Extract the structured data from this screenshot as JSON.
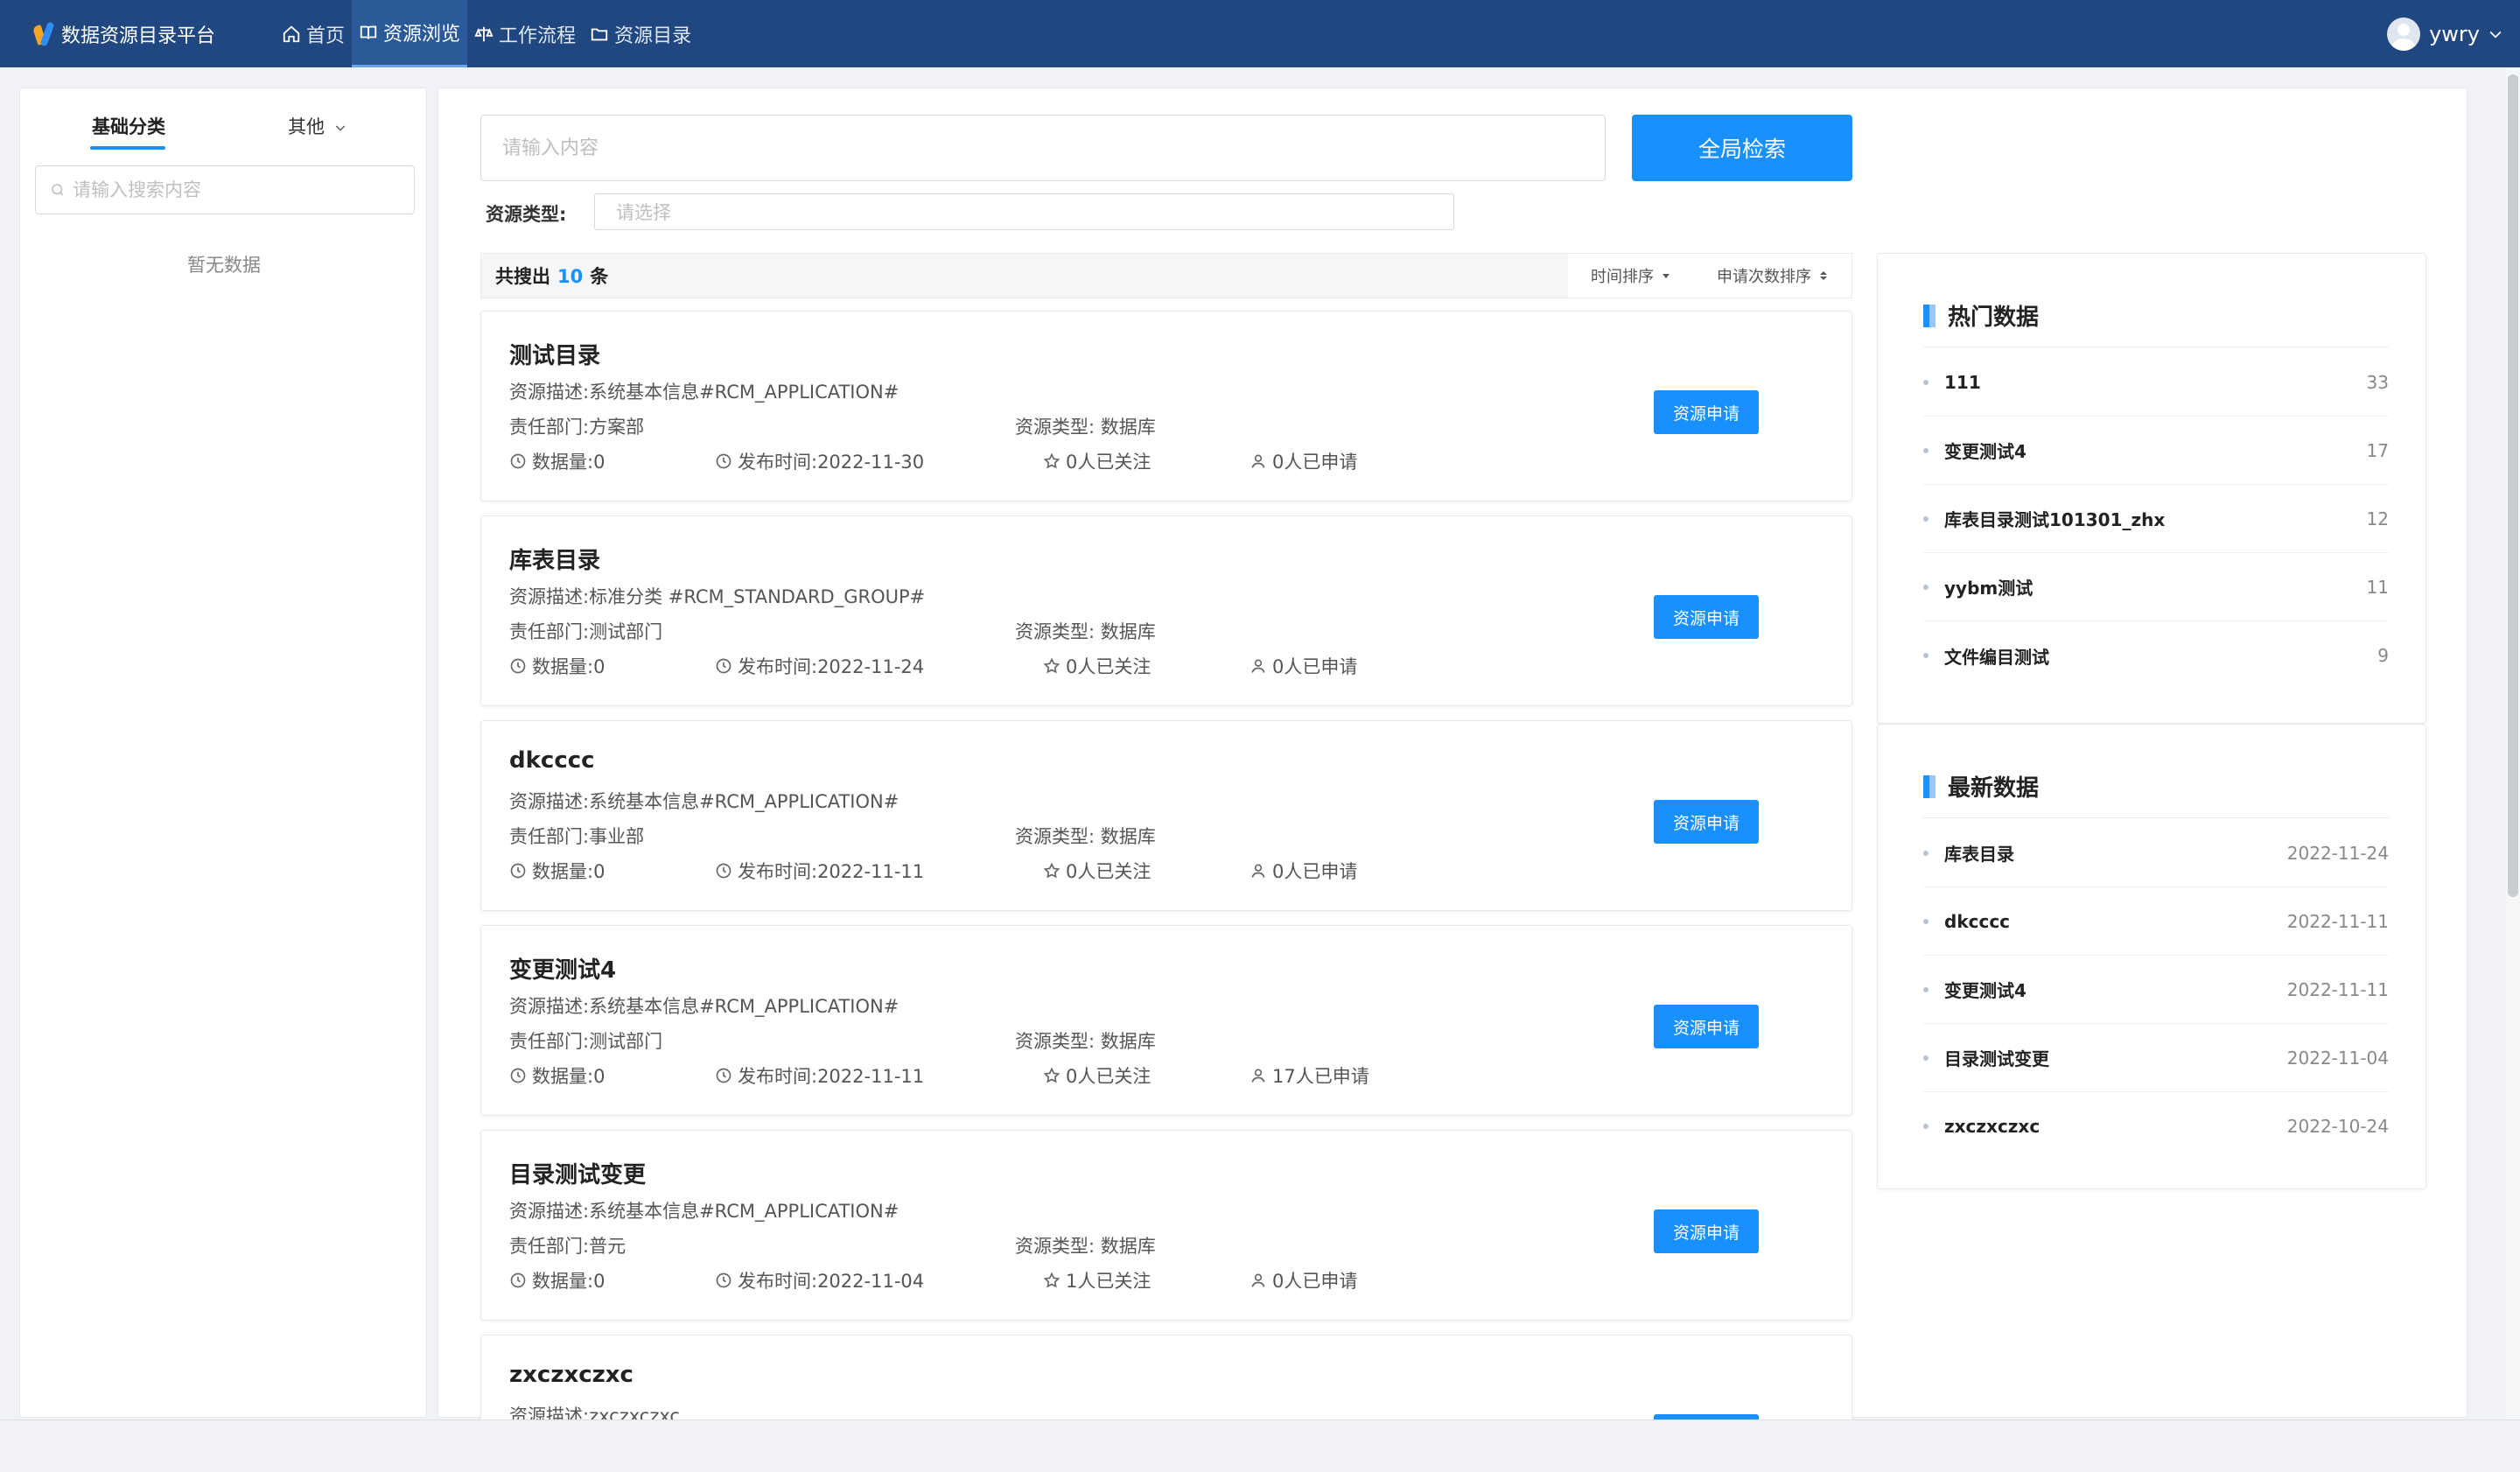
{
  "app": {
    "title": "数据资源目录平台"
  },
  "nav": {
    "items": [
      {
        "label": "首页",
        "icon": "home-icon"
      },
      {
        "label": "资源浏览",
        "icon": "book-icon",
        "active": true
      },
      {
        "label": "工作流程",
        "icon": "scale-icon"
      },
      {
        "label": "资源目录",
        "icon": "folder-icon"
      }
    ]
  },
  "user": {
    "name": "ywry"
  },
  "left": {
    "tabs": [
      "基础分类",
      "其他"
    ],
    "search_placeholder": "请输入搜索内容",
    "empty_text": "暂无数据"
  },
  "search": {
    "placeholder": "请输入内容",
    "button": "全局检索",
    "type_label": "资源类型:",
    "type_placeholder": "请选择"
  },
  "results": {
    "prefix": "共搜出",
    "count": "10",
    "suffix": "条",
    "sort_time": "时间排序",
    "sort_apply": "申请次数排序"
  },
  "cards": [
    {
      "title": "测试目录",
      "desc": "资源描述:系统基本信息#RCM_APPLICATION#",
      "dept": "责任部门:方案部",
      "type": "资源类型:  数据库",
      "count": "数据量:0",
      "date": "发布时间:2022-11-30",
      "follow": "0人已关注",
      "apply": "0人已申请",
      "button": "资源申请"
    },
    {
      "title": "库表目录",
      "desc": "资源描述:标准分类 #RCM_STANDARD_GROUP#",
      "dept": "责任部门:测试部门",
      "type": "资源类型:  数据库",
      "count": "数据量:0",
      "date": "发布时间:2022-11-24",
      "follow": "0人已关注",
      "apply": "0人已申请",
      "button": "资源申请"
    },
    {
      "title": "dkcccc",
      "desc": "资源描述:系统基本信息#RCM_APPLICATION#",
      "dept": "责任部门:事业部",
      "type": "资源类型:  数据库",
      "count": "数据量:0",
      "date": "发布时间:2022-11-11",
      "follow": "0人已关注",
      "apply": "0人已申请",
      "button": "资源申请"
    },
    {
      "title": "变更测试4",
      "desc": "资源描述:系统基本信息#RCM_APPLICATION#",
      "dept": "责任部门:测试部门",
      "type": "资源类型:  数据库",
      "count": "数据量:0",
      "date": "发布时间:2022-11-11",
      "follow": "0人已关注",
      "apply": "17人已申请",
      "button": "资源申请"
    },
    {
      "title": "目录测试变更",
      "desc": "资源描述:系统基本信息#RCM_APPLICATION#",
      "dept": "责任部门:普元",
      "type": "资源类型:  数据库",
      "count": "数据量:0",
      "date": "发布时间:2022-11-04",
      "follow": "1人已关注",
      "apply": "0人已申请",
      "button": "资源申请"
    },
    {
      "title": "zxczxczxc",
      "desc": "资源描述:zxczxczxc",
      "dept": "",
      "type": "",
      "count": "",
      "date": "",
      "follow": "",
      "apply": "",
      "button": "资源申请"
    }
  ],
  "hot": {
    "title": "热门数据",
    "items": [
      {
        "name": "111",
        "value": "33"
      },
      {
        "name": "变更测试4",
        "value": "17"
      },
      {
        "name": "库表目录测试101301_zhx",
        "value": "12"
      },
      {
        "name": "yybm测试",
        "value": "11"
      },
      {
        "name": "文件编目测试",
        "value": "9"
      }
    ]
  },
  "latest": {
    "title": "最新数据",
    "items": [
      {
        "name": "库表目录",
        "value": "2022-11-24"
      },
      {
        "name": "dkcccc",
        "value": "2022-11-11"
      },
      {
        "name": "变更测试4",
        "value": "2022-11-11"
      },
      {
        "name": "目录测试变更",
        "value": "2022-11-04"
      },
      {
        "name": "zxczxczxc",
        "value": "2022-10-24"
      }
    ]
  },
  "colors": {
    "nav_bg": "#20477f",
    "primary": "#1890ff"
  }
}
